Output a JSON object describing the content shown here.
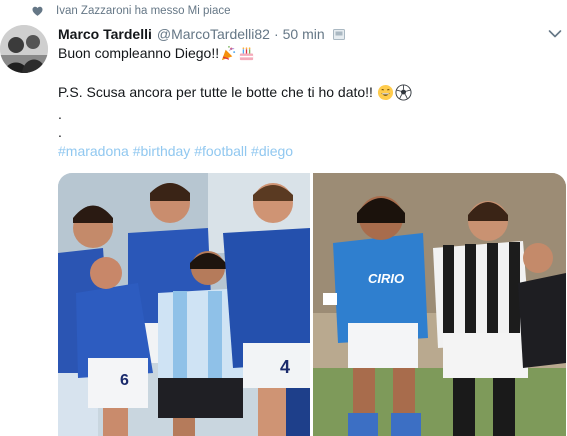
{
  "social_context": {
    "text": "Ivan Zazzaroni ha messo Mi piace",
    "icon": "heart-icon"
  },
  "tweet": {
    "author_name": "Marco Tardelli",
    "handle": "@MarcoTardelli82",
    "separator": "·",
    "time": "50 min",
    "line1": "Buon compleanno Diego!!",
    "line1_emojis": [
      "party-popper-icon",
      "birthday-cake-icon"
    ],
    "line2": "P.S. Scusa ancora per tutte le botte che ti ho dato!!",
    "line2_emojis": [
      "grinning-face-icon",
      "soccer-ball-icon"
    ],
    "dot1": ".",
    "dot2": ".",
    "hashtags": [
      "#maradona",
      "#birthday",
      "#football",
      "#diego"
    ]
  },
  "colors": {
    "text": "#14171a",
    "muted": "#657786",
    "hashtag": "#91c8f0"
  }
}
